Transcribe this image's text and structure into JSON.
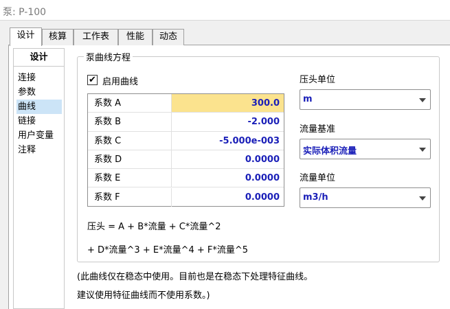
{
  "window": {
    "title": "泵: P-100"
  },
  "tabs": [
    {
      "label": "设计",
      "active": true
    },
    {
      "label": "核算"
    },
    {
      "label": "工作表"
    },
    {
      "label": "性能"
    },
    {
      "label": "动态"
    }
  ],
  "nav": {
    "header": "设计",
    "items": [
      {
        "label": "连接"
      },
      {
        "label": "参数"
      },
      {
        "label": "曲线",
        "selected": true
      },
      {
        "label": "链接"
      },
      {
        "label": "用户变量"
      },
      {
        "label": "注释"
      }
    ]
  },
  "curve": {
    "group_title": "泵曲线方程",
    "enable_label": "启用曲线",
    "enable_checked": true,
    "checkmark": "✔",
    "coefficients": [
      {
        "label": "系数 A",
        "value": "300.0"
      },
      {
        "label": "系数 B",
        "value": "-2.000"
      },
      {
        "label": "系数 C",
        "value": "-5.000e-003"
      },
      {
        "label": "系数 D",
        "value": "0.0000"
      },
      {
        "label": "系数 E",
        "value": "0.0000"
      },
      {
        "label": "系数 F",
        "value": "0.0000"
      }
    ],
    "formula_line1": "压头 = A + B*流量 + C*流量^2",
    "formula_line2": "+ D*流量^3 + E*流量^4 + F*流量^5"
  },
  "fields": {
    "head_unit": {
      "label": "压头单位",
      "value": "m"
    },
    "flow_basis": {
      "label": "流量基准",
      "value": "实际体积流量"
    },
    "flow_unit": {
      "label": "流量单位",
      "value": "m3/h"
    }
  },
  "notes": {
    "line1": "(此曲线仅在稳态中使用。目前也是在稳态下处理特征曲线。",
    "line2": "建议使用特征曲线而不使用系数。)"
  },
  "colors": {
    "value_text": "#1a1fb8",
    "active_cell": "#fbe38e",
    "nav_selected": "#cce4f7"
  }
}
